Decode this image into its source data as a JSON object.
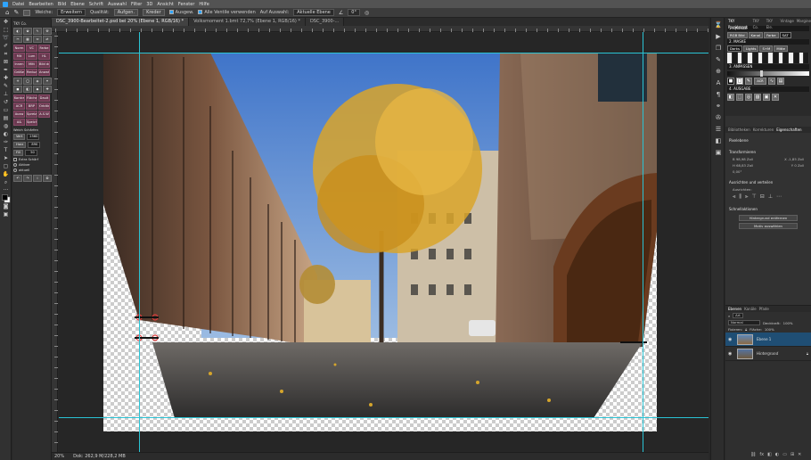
{
  "menubar": {
    "items": [
      "Datei",
      "Bearbeiten",
      "Bild",
      "Ebene",
      "Schrift",
      "Auswahl",
      "Filter",
      "3D",
      "Ansicht",
      "Fenster",
      "Hilfe"
    ]
  },
  "options": {
    "weiche_label": "Weiche:",
    "mode_value": "Erweitern",
    "qualitaet_label": "Qualität:",
    "btn_aufgen": "Aufgen.",
    "btn_kreder": "Kreder",
    "check_ausgew": "Ausgew.",
    "check_alle": "Alle Ventile verwenden",
    "auf_label": "Auf Auswahl:",
    "layer_select": "Aktuelle Ebene",
    "angle": "0°"
  },
  "tabs": [
    {
      "label": "DSC_3900-Bearbeitet-2.psd bei 20% (Ebene 1, RGB/16) *",
      "active": true
    },
    {
      "label": "Volksmoment 1.bmt 72,7% (Ebene 1, RGB/16) *",
      "active": false
    },
    {
      "label": "DSC_3900-...",
      "active": false
    }
  ],
  "left_panel": {
    "title": "TKY Co.",
    "buttons_top": [
      "Norm",
      "VC",
      "Farbe",
      "Mit",
      "Lum",
      "HL",
      "Innen",
      "Mitt",
      "Bild dupl",
      "Größe",
      "Reduz",
      "Anwahl"
    ],
    "buttons_mid": [
      "Kontrast",
      "Flächen",
      "Dauit",
      "ACR",
      "BRP",
      "Orbitinfo",
      "Ausw",
      "Spreiz",
      "A.S.W",
      "A&",
      "Speichern"
    ],
    "weich_label": "Weich Schärfen",
    "vert_label": "Vert",
    "vert_value": "2560",
    "horz_label": "Horz",
    "horz_value": "890",
    "fill_label": "Fill",
    "fill_value": "50",
    "extra_label": "Extra Schärf",
    "option1": "Aktiver",
    "option2": "aktuell"
  },
  "right_panel": {
    "tky_tabs": [
      "TKY Rapidmask",
      "TKY Co.",
      "TKY Ele.",
      "Vintage",
      "Margine"
    ],
    "quelle": "1. QUELLE",
    "maske": "2. MASKE",
    "anpassen": "3. ANPASSEN",
    "ausgabe": "4. AUSGABE",
    "btn_rgb": "RGB Bild",
    "btn_kanal": "Kanal",
    "btn_farbe": "Farbe",
    "btn_sat": "SAT",
    "btn_darks": "Darks",
    "btn_lights": "Lights",
    "btn_mitte": "Mitte",
    "btn_sm": "S+M",
    "btn_acr": "ACR",
    "panel_tabs": [
      "Bibliotheken",
      "Korrekturen",
      "Eigenschaften"
    ],
    "pixel_ebene": "Pixelebene",
    "transform_title": "Transformieren",
    "w_label": "B",
    "w_value": "98,98 Zoll",
    "h_label": "H",
    "h_value": "68,83 Zoll",
    "x_label": "X",
    "x_value": "-1,85 Zoll",
    "y_label": "Y",
    "y_value": "0 Zoll",
    "angle_value": "0,00°",
    "align_title": "Ausrichten und verteilen",
    "align_sub": "Ausrichten:",
    "quick_title": "Schnellaktionen",
    "btn_bg_remove": "Hintergrund entfernen",
    "btn_select_subject": "Motiv auswählen"
  },
  "layers_panel": {
    "tabs": [
      "Ebenen",
      "Kanäle",
      "Pfade"
    ],
    "filter_value": "Art",
    "blend_mode": "Normal",
    "opacity_label": "Deckkraft:",
    "opacity_value": "100%",
    "lock_label": "Fixieren:",
    "fill_label": "Fläche:",
    "fill_value": "100%",
    "layers": [
      {
        "name": "Ebene 1",
        "selected": true
      },
      {
        "name": "Hintergrund",
        "selected": false
      }
    ]
  },
  "status": {
    "zoom": "20%",
    "doc": "Dok: 262,9 M/228,2 MB"
  }
}
